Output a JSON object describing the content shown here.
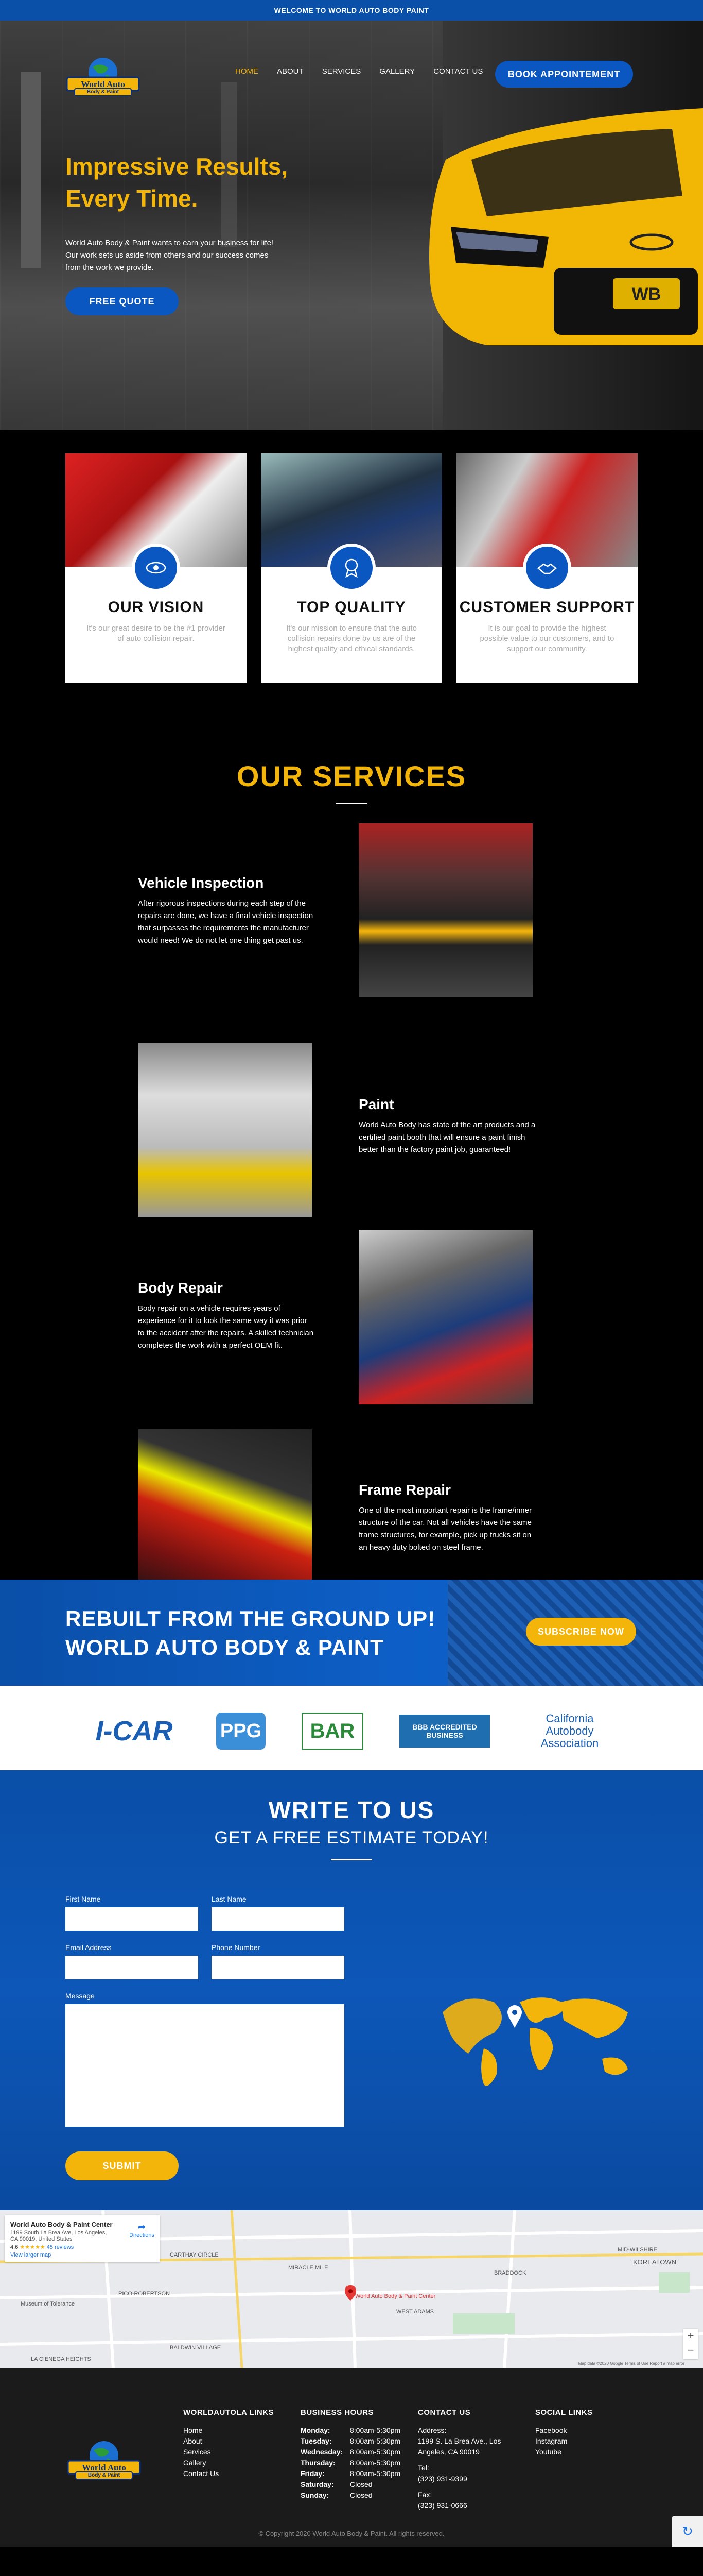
{
  "topbar": {
    "text": "WELCOME TO WORLD AUTO BODY PAINT"
  },
  "brand": {
    "logo_line1": "World Auto",
    "logo_line2": "Body & Paint",
    "primary": "#0a57c2",
    "accent": "#f4b50b"
  },
  "nav": {
    "items": [
      "HOME",
      "ABOUT",
      "SERVICES",
      "GALLERY",
      "CONTACT US"
    ],
    "book_label": "BOOK APPOINTEMENT"
  },
  "hero": {
    "title": "Impressive Results, Every Time.",
    "text": "World Auto Body & Paint wants to earn your business for life! Our work sets us aside from others and our success comes from the work we provide.",
    "cta": "FREE QUOTE",
    "plate": "WB"
  },
  "features": [
    {
      "title": "OUR VISION",
      "text": "It's our great desire to be the #1 provider of auto collision repair.",
      "icon": "eye-icon"
    },
    {
      "title": "TOP QUALITY",
      "text": "It's our mission to ensure that the auto collision repairs done by us are of the highest quality and ethical standards.",
      "icon": "award-icon"
    },
    {
      "title": "CUSTOMER SUPPORT",
      "text": "It is our goal to provide the highest possible value to our customers, and to support our community.",
      "icon": "handshake-icon"
    }
  ],
  "services": {
    "title": "OUR SERVICES",
    "items": [
      {
        "title": "Vehicle Inspection",
        "text": "After rigorous inspections during each step of the repairs are done, we have a final vehicle inspection that surpasses the requirements the manufacturer would need! We do not let one thing get past us."
      },
      {
        "title": "Paint",
        "text": "World Auto Body has state of the art products and a certified paint booth that will ensure a paint finish better than the factory paint job, guaranteed!"
      },
      {
        "title": "Body Repair",
        "text": "Body repair on a vehicle requires years of experience for it to look the same way it was prior to the accident after the repairs. A skilled technician completes the work with a perfect OEM fit."
      },
      {
        "title": "Frame Repair",
        "text": "One of the most important repair is the frame/inner structure of the car. Not all vehicles have the same frame structures, for example, pick up trucks sit on an heavy duty bolted on steel frame."
      }
    ]
  },
  "banner": {
    "line1": "REBUILT FROM THE GROUND UP!",
    "line2": "WORLD AUTO BODY & PAINT",
    "cta": "SUBSCRIBE NOW"
  },
  "partners": [
    "I-CAR",
    "PPG",
    "BAR",
    "BBB ACCREDITED BUSINESS",
    "California Autobody Association"
  ],
  "contact": {
    "title": "WRITE TO US",
    "subtitle": "GET A FREE ESTIMATE TODAY!",
    "first_name": "First Name",
    "last_name": "Last Name",
    "email": "Email Address",
    "phone": "Phone Number",
    "message": "Message",
    "submit": "SUBMIT"
  },
  "map": {
    "name": "World Auto Body & Paint Center",
    "address": "1199 South La Brea Ave, Los Angeles, CA 90019, United States",
    "rating": "4.6",
    "reviews": "45 reviews",
    "directions": "Directions",
    "larger": "View larger map",
    "pin_label": "World Auto Body & Paint Center",
    "places": [
      "CARTHAY CIRCLE",
      "MIRACLE MILE",
      "MID-WILSHIRE",
      "KOREATOWN",
      "PICO-ROBERTSON",
      "WEST ADAMS",
      "BALDWIN VILLAGE",
      "LA CIENEGA HEIGHTS",
      "Museum of Tolerance",
      "BRADDOCK"
    ],
    "credits": "Map data ©2020 Google  Terms of Use  Report a map error"
  },
  "footer": {
    "links_title": "WORLDAUTOLA LINKS",
    "links": [
      "Home",
      "About",
      "Services",
      "Gallery",
      "Contact Us"
    ],
    "hours_title": "BUSINESS HOURS",
    "hours": [
      {
        "day": "Monday:",
        "time": "8:00am-5:30pm"
      },
      {
        "day": "Tuesday:",
        "time": "8:00am-5:30pm"
      },
      {
        "day": "Wednesday:",
        "time": "8:00am-5:30pm"
      },
      {
        "day": "Thursday:",
        "time": "8:00am-5:30pm"
      },
      {
        "day": "Friday:",
        "time": "8:00am-5:30pm"
      },
      {
        "day": "Saturday:",
        "time": "Closed"
      },
      {
        "day": "Sunday:",
        "time": "Closed"
      }
    ],
    "contact_title": "CONTACT US",
    "address_label": "Address:",
    "address": "1199 S. La Brea Ave., Los Angeles, CA 90019",
    "tel_label": "Tel:",
    "tel": "(323) 931-9399",
    "fax_label": "Fax:",
    "fax": "(323) 931-0666",
    "social_title": "SOCIAL LINKS",
    "social": [
      "Facebook",
      "Instagram",
      "Youtube"
    ],
    "copyright": "© Copyright 2020 World Auto Body & Paint. All rights reserved."
  }
}
